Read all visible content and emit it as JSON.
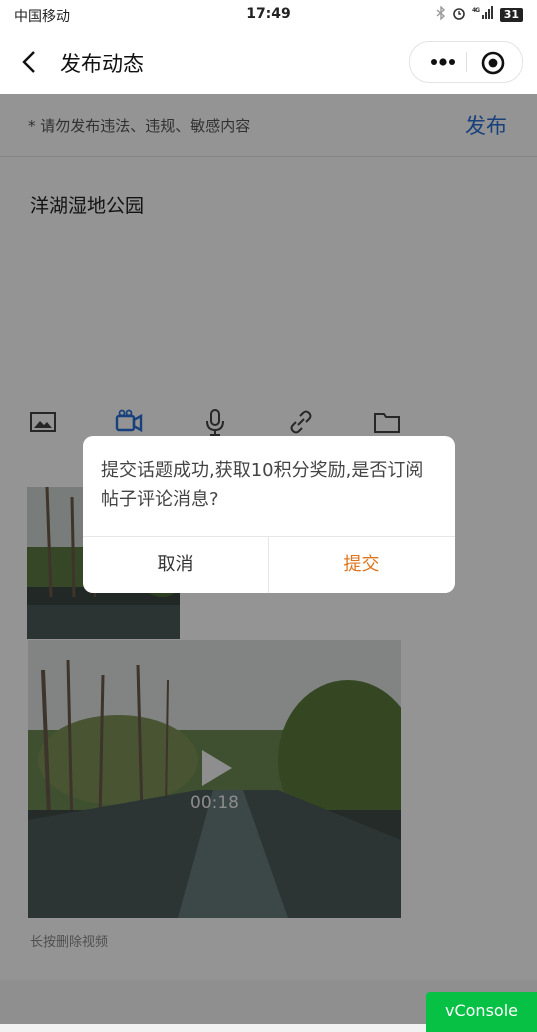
{
  "status_bar": {
    "carrier": "中国移动",
    "time": "17:49",
    "battery": "31",
    "network": "4G"
  },
  "nav": {
    "title": "发布动态"
  },
  "notice": {
    "warning": "* 请勿发布违法、违规、敏感内容",
    "publish_label": "发布"
  },
  "editor": {
    "topic_text": "洋湖湿地公园"
  },
  "toolbar": {
    "icons": [
      "image-icon",
      "video-icon",
      "microphone-icon",
      "link-icon",
      "folder-icon"
    ],
    "active": "video-icon",
    "active_color": "#2a6fd6"
  },
  "video": {
    "duration": "00:18",
    "hint": "长按删除视频"
  },
  "dialog": {
    "message": "提交话题成功,获取10积分奖励,是否订阅帖子评论消息?",
    "cancel_label": "取消",
    "confirm_label": "提交",
    "confirm_color": "#e0741d"
  },
  "vconsole": {
    "label": "vConsole"
  }
}
